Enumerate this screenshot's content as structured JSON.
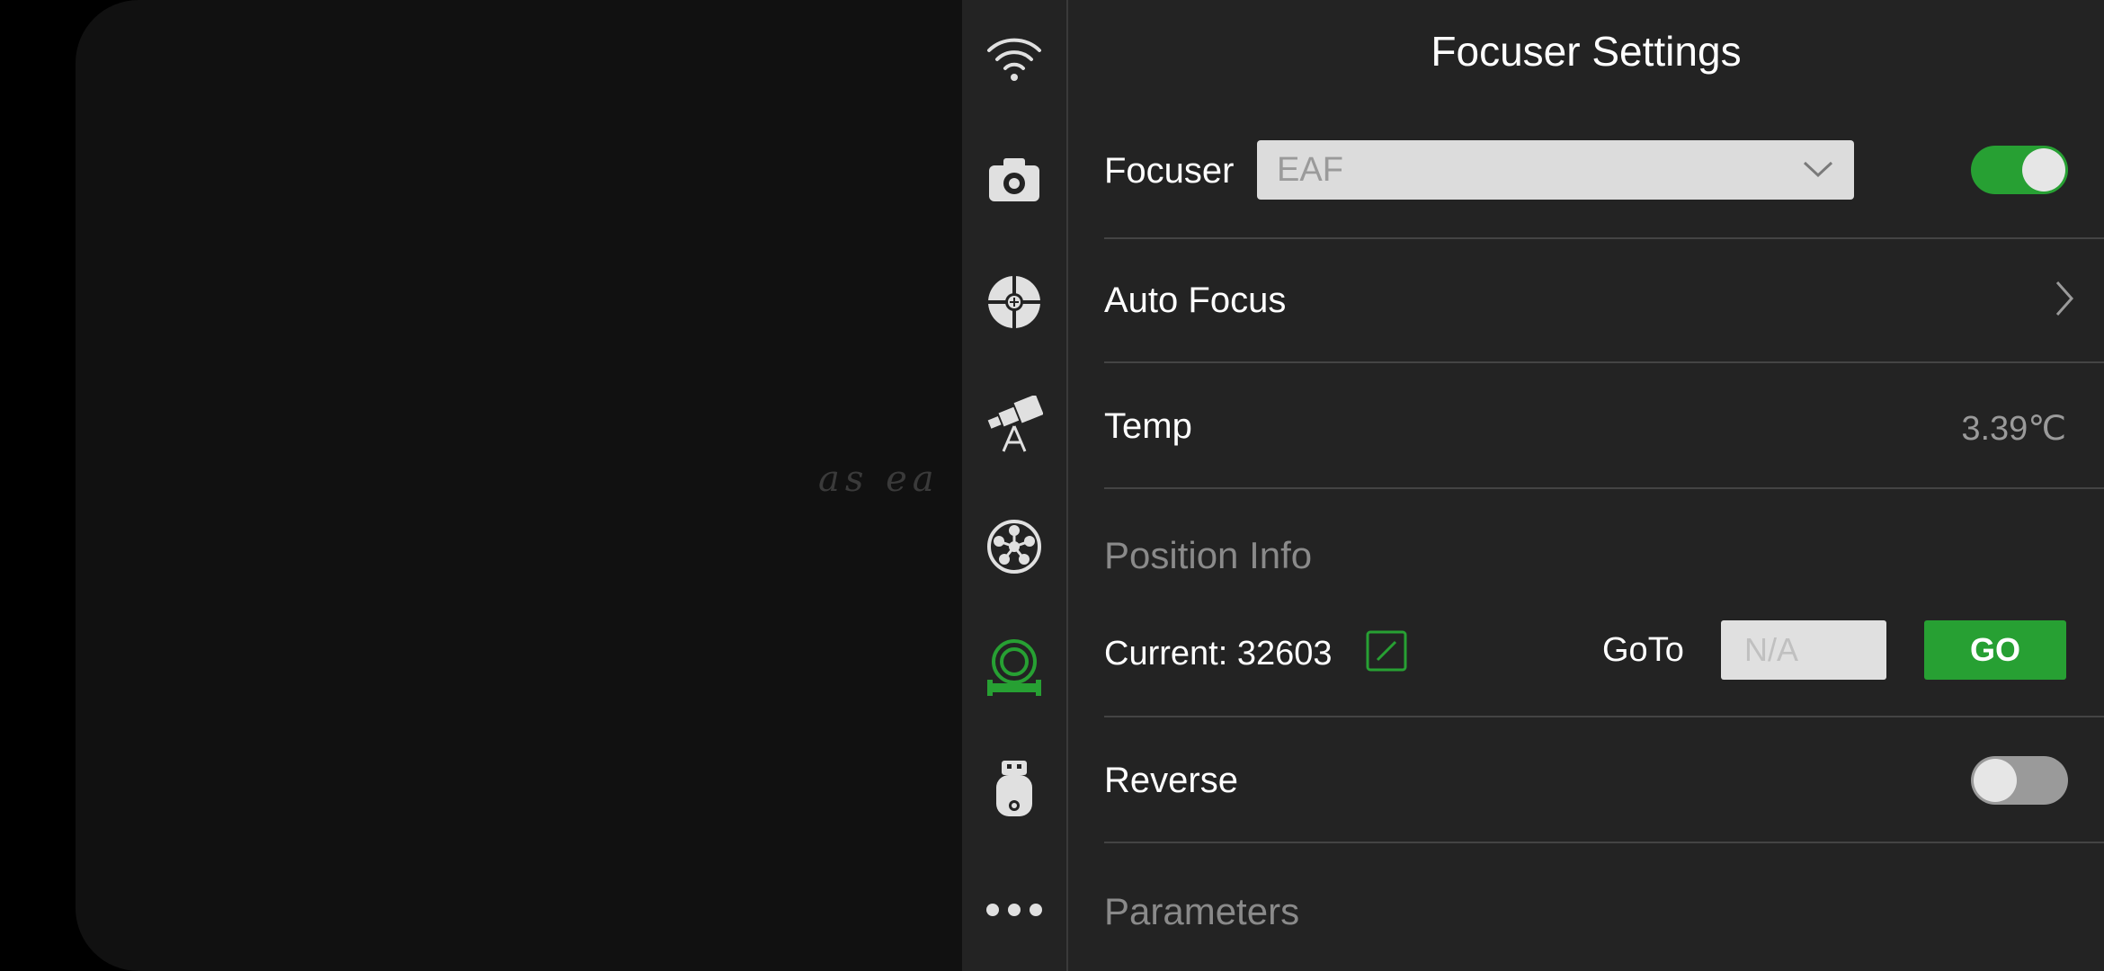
{
  "preview": {
    "overlay_text": "as ea"
  },
  "sidebar": {
    "items": [
      {
        "name": "wifi",
        "icon": "wifi-icon"
      },
      {
        "name": "camera",
        "icon": "camera-icon"
      },
      {
        "name": "guide",
        "icon": "crosshair-icon"
      },
      {
        "name": "telescope",
        "icon": "telescope-icon"
      },
      {
        "name": "filter-wheel",
        "icon": "filter-wheel-icon"
      },
      {
        "name": "focuser",
        "icon": "focuser-icon",
        "active": true
      },
      {
        "name": "usb",
        "icon": "usb-drive-icon"
      },
      {
        "name": "more",
        "icon": "more-icon"
      }
    ],
    "active_color": "#27a033",
    "icon_color": "#e0e0e0"
  },
  "panel": {
    "title": "Focuser Settings",
    "focuser": {
      "label": "Focuser",
      "selected": "EAF",
      "enabled": true
    },
    "auto_focus": {
      "label": "Auto Focus"
    },
    "temp": {
      "label": "Temp",
      "value": "3.39℃"
    },
    "position_info": {
      "section_label": "Position Info",
      "current_label": "Current: 32603",
      "goto_label": "GoTo",
      "goto_placeholder": "N/A",
      "go_label": "GO"
    },
    "reverse": {
      "label": "Reverse",
      "enabled": false
    },
    "parameters": {
      "section_label": "Parameters"
    }
  }
}
